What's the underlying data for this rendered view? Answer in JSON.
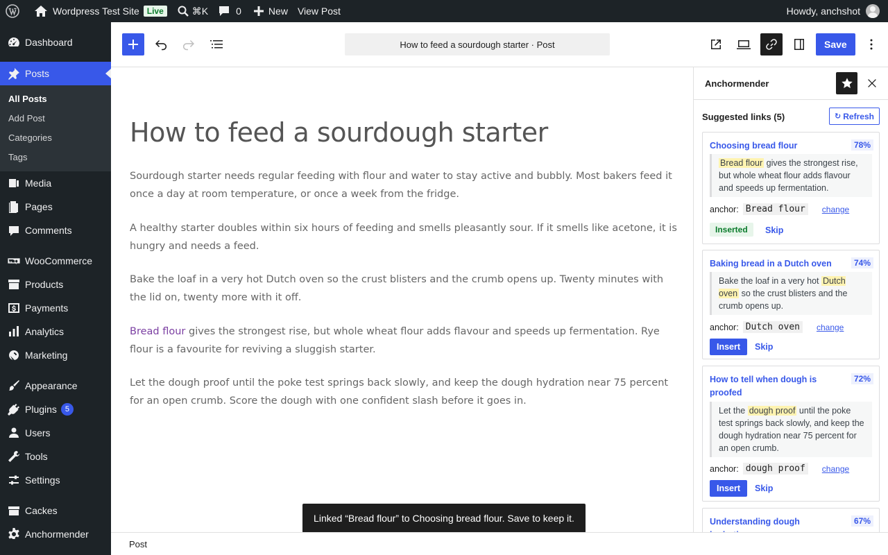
{
  "adminbar": {
    "site_name": "Wordpress Test Site",
    "live_badge": "Live",
    "search_shortcut": "⌘K",
    "comments_count": "0",
    "new_label": "New",
    "view_post": "View Post",
    "howdy": "Howdy, anchshot"
  },
  "sidebar": {
    "dashboard": "Dashboard",
    "posts": "Posts",
    "posts_sub": {
      "all": "All Posts",
      "add": "Add Post",
      "categories": "Categories",
      "tags": "Tags"
    },
    "media": "Media",
    "pages": "Pages",
    "comments": "Comments",
    "woocommerce": "WooCommerce",
    "products": "Products",
    "payments": "Payments",
    "analytics": "Analytics",
    "marketing": "Marketing",
    "appearance": "Appearance",
    "plugins": "Plugins",
    "plugins_badge": "5",
    "users": "Users",
    "tools": "Tools",
    "settings": "Settings",
    "cackes": "Cackes",
    "anchormender": "Anchormender"
  },
  "toolbar": {
    "document_title": "How to feed a sourdough starter · Post",
    "save_label": "Save"
  },
  "editor": {
    "title": "How to feed a sourdough starter",
    "p1": "Sourdough starter needs regular feeding with flour and water to stay active and bubbly. Most bakers feed it once a day at room temperature, or once a week from the fridge.",
    "p2": "A healthy starter doubles within six hours of feeding and smells pleasantly sour. If it smells like acetone, it is hungry and needs a feed.",
    "p3": "Bake the loaf in a very hot Dutch oven so the crust blisters and the crumb opens up. Twenty minutes with the lid on, twenty more with it off.",
    "p4_link": "Bread flour",
    "p4_rest": " gives the strongest rise, but whole wheat flour adds flavour and speeds up fermentation. Rye flour is a favourite for reviving a sluggish starter.",
    "p5": "Let the dough proof until the poke test springs back slowly, and keep the dough hydration near 75 percent for an open crumb. Score the dough with one confident slash before it goes in."
  },
  "snackbar": "Linked “Bread flour” to Choosing bread flour. Save to keep it.",
  "footer": "Post",
  "panel": {
    "title": "Anchormender",
    "suggested": "Suggested links (5)",
    "refresh": "Refresh",
    "anchor_label": "anchor:",
    "change_label": "change",
    "skip_label": "Skip",
    "insert_label": "Insert",
    "inserted_label": "Inserted",
    "cards": [
      {
        "title": "Choosing bread flour",
        "score": "78%",
        "hl": "Bread flour",
        "before": "",
        "after": " gives the strongest rise, but whole wheat flour adds flavour and speeds up fermentation.",
        "anchor": "Bread flour"
      },
      {
        "title": "Baking bread in a Dutch oven",
        "score": "74%",
        "before": "Bake the loaf in a very hot ",
        "hl": "Dutch oven",
        "after": " so the crust blisters and the crumb opens up.",
        "anchor": "Dutch oven"
      },
      {
        "title": "How to tell when dough is proofed",
        "score": "72%",
        "before": "Let the ",
        "hl": "dough proof",
        "after": " until the poke test springs back slowly, and keep the dough hydration near 75 percent for an open crumb.",
        "anchor": "dough proof"
      },
      {
        "title": "Understanding dough hydration",
        "score": "67%"
      }
    ]
  }
}
